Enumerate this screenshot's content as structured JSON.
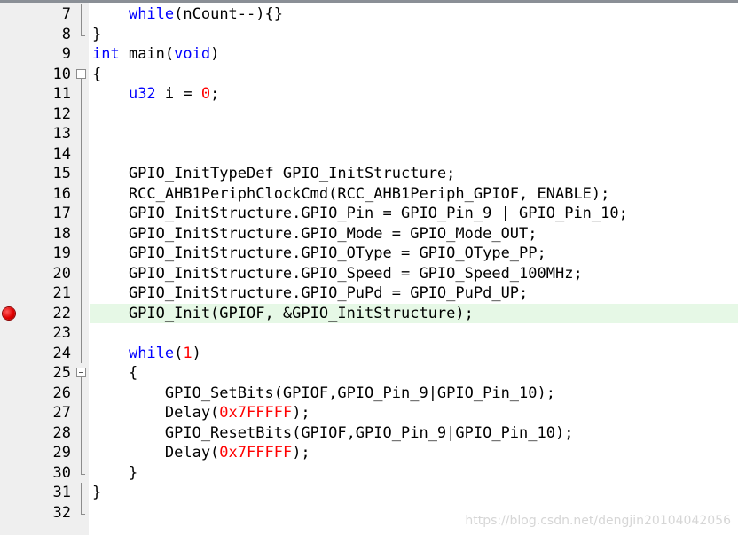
{
  "editor": {
    "breakpoint_line": 22,
    "highlight_line": 22,
    "colors": {
      "gutter_bg": "#efefef",
      "highlight_bg": "#e6f8e6",
      "keyword": "#0000ff",
      "number": "#ff0000",
      "breakpoint": "#e00000"
    },
    "lines": [
      {
        "num": "7",
        "fold": "line",
        "tokens": [
          {
            "t": "    ",
            "c": "plain"
          },
          {
            "t": "while",
            "c": "kw"
          },
          {
            "t": "(nCount--){}",
            "c": "plain"
          }
        ]
      },
      {
        "num": "8",
        "fold": "end",
        "tokens": [
          {
            "t": "}",
            "c": "plain"
          }
        ]
      },
      {
        "num": "9",
        "fold": "none",
        "tokens": [
          {
            "t": "int",
            "c": "kw"
          },
          {
            "t": " main(",
            "c": "plain"
          },
          {
            "t": "void",
            "c": "kw"
          },
          {
            "t": ")",
            "c": "plain"
          }
        ]
      },
      {
        "num": "10",
        "fold": "open",
        "tokens": [
          {
            "t": "{",
            "c": "plain"
          }
        ]
      },
      {
        "num": "11",
        "fold": "line",
        "tokens": [
          {
            "t": "    ",
            "c": "plain"
          },
          {
            "t": "u32",
            "c": "kw"
          },
          {
            "t": " i = ",
            "c": "plain"
          },
          {
            "t": "0",
            "c": "num"
          },
          {
            "t": ";",
            "c": "plain"
          }
        ]
      },
      {
        "num": "12",
        "fold": "line",
        "tokens": []
      },
      {
        "num": "13",
        "fold": "line",
        "tokens": []
      },
      {
        "num": "14",
        "fold": "line",
        "tokens": []
      },
      {
        "num": "15",
        "fold": "line",
        "tokens": [
          {
            "t": "    GPIO_InitTypeDef GPIO_InitStructure;",
            "c": "plain"
          }
        ]
      },
      {
        "num": "16",
        "fold": "line",
        "tokens": [
          {
            "t": "    RCC_AHB1PeriphClockCmd(RCC_AHB1Periph_GPIOF, ENABLE);",
            "c": "plain"
          }
        ]
      },
      {
        "num": "17",
        "fold": "line",
        "tokens": [
          {
            "t": "    GPIO_InitStructure.GPIO_Pin = GPIO_Pin_9 | GPIO_Pin_10;",
            "c": "plain"
          }
        ]
      },
      {
        "num": "18",
        "fold": "line",
        "tokens": [
          {
            "t": "    GPIO_InitStructure.GPIO_Mode = GPIO_Mode_OUT;",
            "c": "plain"
          }
        ]
      },
      {
        "num": "19",
        "fold": "line",
        "tokens": [
          {
            "t": "    GPIO_InitStructure.GPIO_OType = GPIO_OType_PP;",
            "c": "plain"
          }
        ]
      },
      {
        "num": "20",
        "fold": "line",
        "tokens": [
          {
            "t": "    GPIO_InitStructure.GPIO_Speed = GPIO_Speed_100MHz;",
            "c": "plain"
          }
        ]
      },
      {
        "num": "21",
        "fold": "line",
        "tokens": [
          {
            "t": "    GPIO_InitStructure.GPIO_PuPd = GPIO_PuPd_UP;",
            "c": "plain"
          }
        ]
      },
      {
        "num": "22",
        "fold": "line",
        "tokens": [
          {
            "t": "    GPIO_Init(GPIOF, &GPIO_InitStructure);",
            "c": "plain"
          }
        ]
      },
      {
        "num": "23",
        "fold": "line",
        "tokens": []
      },
      {
        "num": "24",
        "fold": "line",
        "tokens": [
          {
            "t": "    ",
            "c": "plain"
          },
          {
            "t": "while",
            "c": "kw"
          },
          {
            "t": "(",
            "c": "plain"
          },
          {
            "t": "1",
            "c": "num"
          },
          {
            "t": ")",
            "c": "plain"
          }
        ]
      },
      {
        "num": "25",
        "fold": "open",
        "tokens": [
          {
            "t": "    {",
            "c": "plain"
          }
        ]
      },
      {
        "num": "26",
        "fold": "line",
        "tokens": [
          {
            "t": "        GPIO_SetBits(GPIOF,GPIO_Pin_9|GPIO_Pin_10);",
            "c": "plain"
          }
        ]
      },
      {
        "num": "27",
        "fold": "line",
        "tokens": [
          {
            "t": "        Delay(",
            "c": "plain"
          },
          {
            "t": "0x7FFFFF",
            "c": "num"
          },
          {
            "t": ");",
            "c": "plain"
          }
        ]
      },
      {
        "num": "28",
        "fold": "line",
        "tokens": [
          {
            "t": "        GPIO_ResetBits(GPIOF,GPIO_Pin_9|GPIO_Pin_10);",
            "c": "plain"
          }
        ]
      },
      {
        "num": "29",
        "fold": "line",
        "tokens": [
          {
            "t": "        Delay(",
            "c": "plain"
          },
          {
            "t": "0x7FFFFF",
            "c": "num"
          },
          {
            "t": ");",
            "c": "plain"
          }
        ]
      },
      {
        "num": "30",
        "fold": "end",
        "tokens": [
          {
            "t": "    }",
            "c": "plain"
          }
        ]
      },
      {
        "num": "31",
        "fold": "line",
        "tokens": [
          {
            "t": "}",
            "c": "plain"
          }
        ]
      },
      {
        "num": "32",
        "fold": "end",
        "tokens": []
      }
    ]
  },
  "watermark": "https://blog.csdn.net/dengjin20104042056"
}
